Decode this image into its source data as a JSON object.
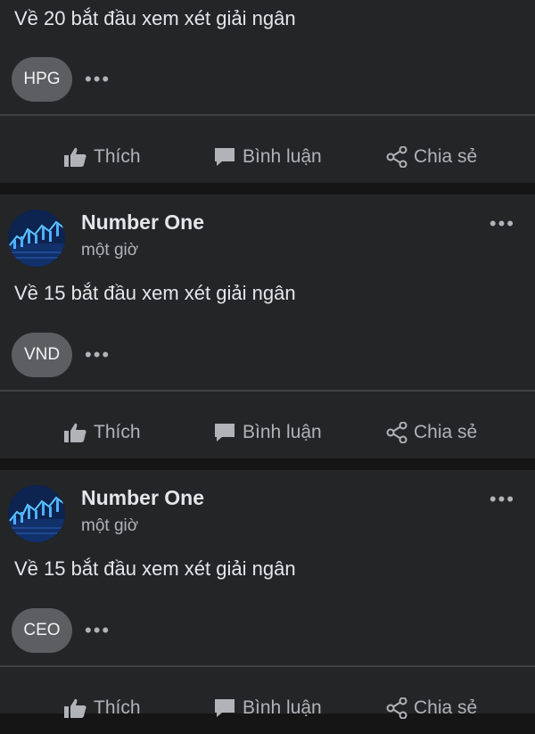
{
  "actions": {
    "like": "Thích",
    "comment": "Bình luận",
    "share": "Chia sẻ"
  },
  "icons": [
    "thumbs-up-icon",
    "comment-bubble-icon",
    "share-icon",
    "more-options-icon"
  ],
  "more_glyph": "•••",
  "posts": [
    {
      "text": "Về 20 bắt đầu xem xét giải ngân",
      "tag": "HPG"
    },
    {
      "author": "Number One",
      "time": "một giờ",
      "text": "Về 15 bắt đầu xem xét giải ngân",
      "tag": "VND"
    },
    {
      "author": "Number One",
      "time": "một giờ",
      "text": "Về 15 bắt đầu xem xét giải ngân",
      "tag": "CEO"
    }
  ]
}
